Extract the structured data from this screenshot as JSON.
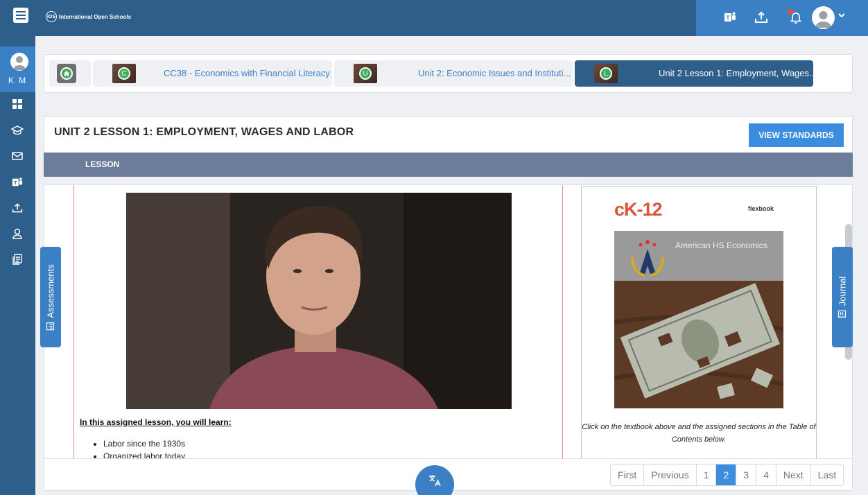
{
  "app": {
    "logo_text": "International Open Schools",
    "logo_mark": "iOS"
  },
  "user": {
    "initials": "K M"
  },
  "breadcrumb": [
    {
      "badge": "C",
      "label": "CC38 - Economics with Financial Literacy"
    },
    {
      "badge": "U",
      "label": "Unit 2: Economic Issues and Instituti..."
    },
    {
      "badge": "L",
      "label": "Unit 2 Lesson 1: Employment, Wages..."
    }
  ],
  "lesson": {
    "title": "UNIT 2 LESSON 1: EMPLOYMENT, WAGES AND LABOR",
    "view_standards": "VIEW STANDARDS",
    "tab": "LESSON"
  },
  "content": {
    "learn_heading": "In this assigned lesson, you will learn:",
    "learn_items": [
      "Labor since the 1930s",
      "Organized labor today"
    ],
    "textbook": {
      "logo": "cK-12",
      "flexbook": "flexbook",
      "cover_title": "American HS Economics",
      "caption": "Click on the textbook above and the assigned sections in the Table of Contents below."
    }
  },
  "side_tabs": {
    "assessments": "Assessments",
    "journal": "Journal"
  },
  "pagination": {
    "first": "First",
    "previous": "Previous",
    "pages": [
      "1",
      "2",
      "3",
      "4"
    ],
    "current": "2",
    "next": "Next",
    "last": "Last"
  },
  "colors": {
    "topbar": "#2d5f8a",
    "accent": "#3b7fc4",
    "button": "#3b8de0",
    "tabbar": "#6b7d9a"
  }
}
